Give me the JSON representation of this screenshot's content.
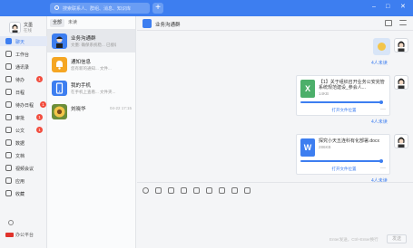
{
  "topbar": {
    "search_placeholder": "搜索联系人、群组、消息、知识库",
    "plus_label": "+",
    "min_label": "–",
    "max_label": "□",
    "close_label": "✕"
  },
  "me": {
    "name": "文墨",
    "dept": "在线"
  },
  "nav": {
    "items": [
      {
        "label": "聊天",
        "badge": "",
        "icon": "chat-icon",
        "active": true
      },
      {
        "label": "工作台",
        "badge": "",
        "icon": "workbench-icon"
      },
      {
        "label": "通讯录",
        "badge": "",
        "icon": "contacts-icon"
      },
      {
        "label": "待办",
        "badge": "1",
        "icon": "todo-icon"
      },
      {
        "label": "日程",
        "badge": "",
        "icon": "calendar-icon"
      },
      {
        "label": "待办日程",
        "badge": "1",
        "icon": "todo-schedule-icon"
      },
      {
        "label": "审批",
        "badge": "1",
        "icon": "approval-icon"
      },
      {
        "label": "公文",
        "badge": "1",
        "icon": "document-icon"
      },
      {
        "label": "数据",
        "badge": "",
        "icon": "data-icon"
      },
      {
        "label": "文档",
        "badge": "",
        "icon": "docs-icon"
      },
      {
        "label": "视频会议",
        "badge": "",
        "icon": "video-icon"
      },
      {
        "label": "应用",
        "badge": "",
        "icon": "apps-icon"
      },
      {
        "label": "收藏",
        "badge": "",
        "icon": "favorites-icon"
      }
    ],
    "footer_label": "办公平台"
  },
  "conversation_list": {
    "tabs": [
      "全部",
      "未读"
    ],
    "items": [
      {
        "title": "业务沟通群",
        "preview": "文墨: 确保系统稳... 已接收",
        "time": "",
        "color": "#3d7ef0"
      },
      {
        "title": "通知信息",
        "preview": "您有新的通知... 文件...",
        "time": "",
        "color": "#f5a623"
      },
      {
        "title": "我的手机",
        "preview": "在手机上查看... 文件夹...",
        "time": "",
        "color": "#3d7ef0"
      },
      {
        "title": "刘晓华",
        "preview": "",
        "time": "04-22 17:15",
        "color": "#f3c54a"
      }
    ]
  },
  "chat": {
    "title": "业务沟通群",
    "messages": [
      {
        "type": "sticker",
        "read": "4人未读"
      },
      {
        "type": "file",
        "icon_letter": "X",
        "icon_color": "#4caf6a",
        "name": "【1】关于组织召开业务公安完管系统规范建设_参会人...",
        "size": "14KB",
        "open_label": "打开文件位置",
        "read": "4人未读"
      },
      {
        "type": "file",
        "icon_letter": "W",
        "icon_color": "#3d7ef0",
        "name": "探究小天五连科有化部署.docx",
        "size": "286KB",
        "open_label": "打开文件位置",
        "read": "4人未读"
      }
    ],
    "composer": {
      "hint": "Enter发送，Ctrl+Enter换行",
      "send_label": "发送"
    }
  }
}
